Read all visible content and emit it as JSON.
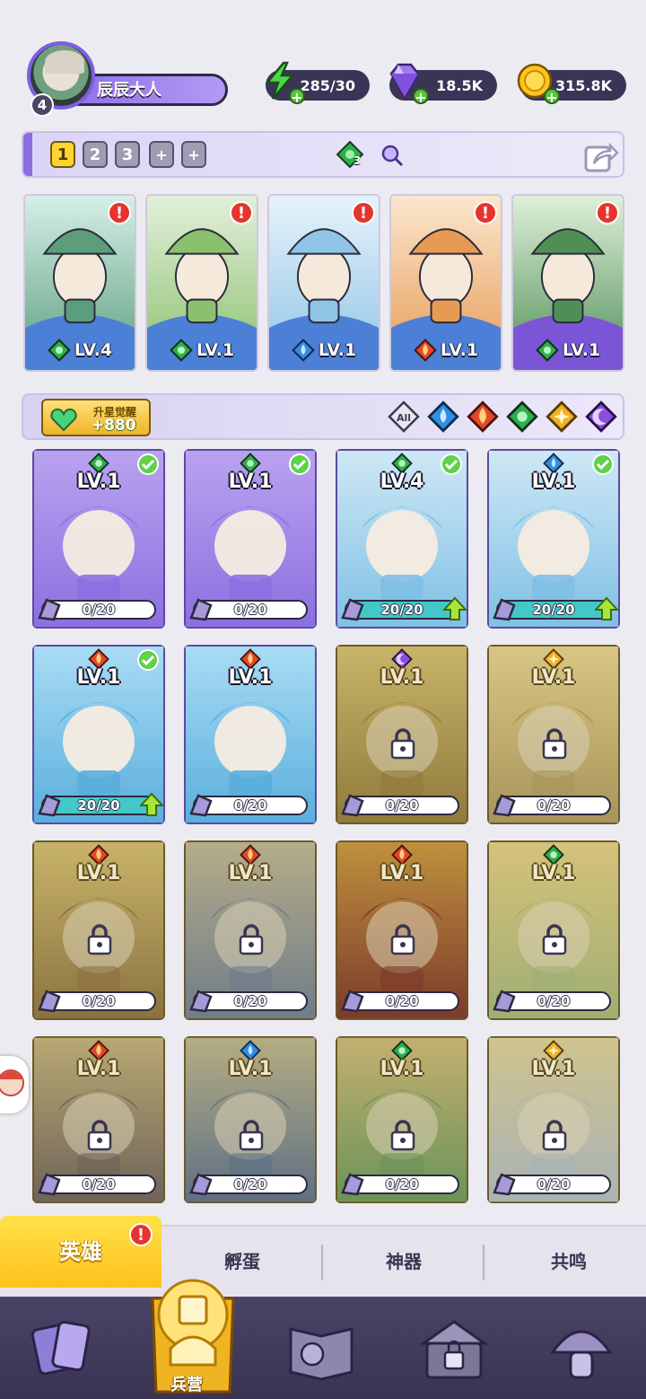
{
  "player": {
    "level": "4",
    "name": "辰辰大人"
  },
  "resources": {
    "energy": "285/30",
    "gems": "18.5K",
    "gold": "315.8K"
  },
  "teams": {
    "tabs": [
      "1",
      "2",
      "3"
    ],
    "add_symbol": "+",
    "element_count": "3"
  },
  "team_cards": [
    {
      "level": "LV.4",
      "element": "wood",
      "colors": [
        "#d6efe8",
        "#5b9d7c"
      ],
      "foot": [
        "#6aa8e8",
        "#4c7fd6"
      ]
    },
    {
      "level": "LV.1",
      "element": "wood",
      "colors": [
        "#e3f0da",
        "#8ac06e"
      ],
      "foot": [
        "#6aa8e8",
        "#4c7fd6"
      ]
    },
    {
      "level": "LV.1",
      "element": "water",
      "colors": [
        "#e7f2fb",
        "#8fc4e6"
      ],
      "foot": [
        "#6aa8e8",
        "#4c7fd6"
      ]
    },
    {
      "level": "LV.1",
      "element": "fire",
      "colors": [
        "#fbe6cf",
        "#e79a53"
      ],
      "foot": [
        "#6aa8e8",
        "#4c7fd6"
      ]
    },
    {
      "level": "LV.1",
      "element": "wood",
      "colors": [
        "#dff0d9",
        "#4f8f56"
      ],
      "foot": [
        "#9f7be8",
        "#7a55d6"
      ]
    }
  ],
  "alert_symbol": "!",
  "awaken": {
    "title": "升星觉醒",
    "value": "+880"
  },
  "filters": [
    "All",
    "water",
    "fire",
    "wood",
    "light",
    "dark"
  ],
  "filter_all_label": "All",
  "heroes": [
    {
      "level": "LV.1",
      "element": "wood",
      "progress": "0/20",
      "fill": 0,
      "locked": false,
      "check": true,
      "upgrade": false,
      "bg": [
        "#b9a3ef",
        "#8c6fe0"
      ]
    },
    {
      "level": "LV.1",
      "element": "wood",
      "progress": "0/20",
      "fill": 0,
      "locked": false,
      "check": true,
      "upgrade": false,
      "bg": [
        "#b9a3ef",
        "#8c6fe0"
      ]
    },
    {
      "level": "LV.4",
      "element": "wood",
      "progress": "20/20",
      "fill": 1,
      "locked": false,
      "check": true,
      "upgrade": true,
      "bg": [
        "#cfe8f5",
        "#7fc0e4"
      ]
    },
    {
      "level": "LV.1",
      "element": "water",
      "progress": "20/20",
      "fill": 1,
      "locked": false,
      "check": true,
      "upgrade": true,
      "bg": [
        "#cfe8f5",
        "#7fc0e4"
      ]
    },
    {
      "level": "LV.1",
      "element": "fire",
      "progress": "20/20",
      "fill": 1,
      "locked": false,
      "check": true,
      "upgrade": true,
      "bg": [
        "#a9dcf4",
        "#5aaedc"
      ]
    },
    {
      "level": "LV.1",
      "element": "fire",
      "progress": "0/20",
      "fill": 0,
      "locked": false,
      "check": false,
      "upgrade": false,
      "bg": [
        "#a9dcf4",
        "#5aaedc"
      ]
    },
    {
      "level": "LV.1",
      "element": "dark",
      "progress": "0/20",
      "fill": 0,
      "locked": true,
      "check": false,
      "upgrade": false,
      "bg": [
        "#c9b46a",
        "#8f7a3c"
      ]
    },
    {
      "level": "LV.1",
      "element": "light",
      "progress": "0/20",
      "fill": 0,
      "locked": true,
      "check": false,
      "upgrade": false,
      "bg": [
        "#d8c784",
        "#a8945a"
      ]
    },
    {
      "level": "LV.1",
      "element": "fire",
      "progress": "0/20",
      "fill": 0,
      "locked": true,
      "check": false,
      "upgrade": false,
      "bg": [
        "#c9b46a",
        "#8a7240"
      ]
    },
    {
      "level": "LV.1",
      "element": "fire",
      "progress": "0/20",
      "fill": 0,
      "locked": true,
      "check": false,
      "upgrade": false,
      "bg": [
        "#b6ad8a",
        "#6f7c8a"
      ]
    },
    {
      "level": "LV.1",
      "element": "fire",
      "progress": "0/20",
      "fill": 0,
      "locked": true,
      "check": false,
      "upgrade": false,
      "bg": [
        "#c0913e",
        "#7b3a2a"
      ]
    },
    {
      "level": "LV.1",
      "element": "wood",
      "progress": "0/20",
      "fill": 0,
      "locked": true,
      "check": false,
      "upgrade": false,
      "bg": [
        "#d6c27a",
        "#9fae74"
      ]
    },
    {
      "level": "LV.1",
      "element": "fire",
      "progress": "0/20",
      "fill": 0,
      "locked": true,
      "check": false,
      "upgrade": false,
      "bg": [
        "#b9a973",
        "#6e6358"
      ]
    },
    {
      "level": "LV.1",
      "element": "water",
      "progress": "0/20",
      "fill": 0,
      "locked": true,
      "check": false,
      "upgrade": false,
      "bg": [
        "#b5ad83",
        "#5e6f84"
      ]
    },
    {
      "level": "LV.1",
      "element": "wood",
      "progress": "0/20",
      "fill": 0,
      "locked": true,
      "check": false,
      "upgrade": false,
      "bg": [
        "#c4b071",
        "#6a9357"
      ]
    },
    {
      "level": "LV.1",
      "element": "light",
      "progress": "0/20",
      "fill": 0,
      "locked": true,
      "check": false,
      "upgrade": false,
      "bg": [
        "#cfc48e",
        "#a9b3b4"
      ]
    }
  ],
  "subtabs": {
    "heroes": "英雄",
    "hatch": "孵蛋",
    "artifact": "神器",
    "resonance": "共鸣"
  },
  "bottom_nav": {
    "barracks": "兵营"
  },
  "element_colors": {
    "wood": "#2fae4c",
    "water": "#2f8fe0",
    "fire": "#e04a2a",
    "light": "#f0b028",
    "dark": "#8a4fd8"
  }
}
